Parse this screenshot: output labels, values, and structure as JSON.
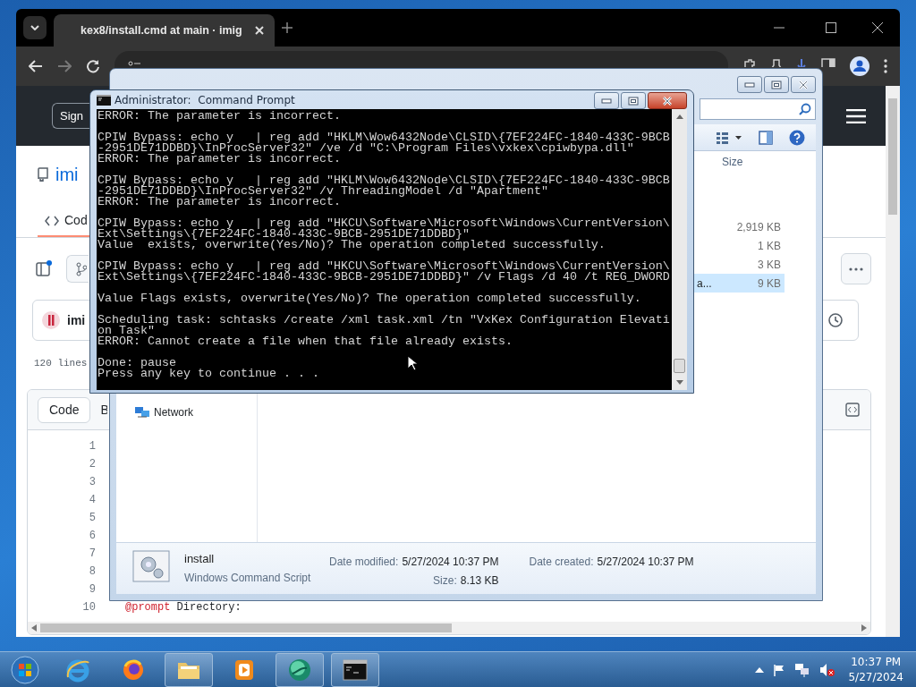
{
  "browser": {
    "tab_title": "kex8/install.cmd at main · imig",
    "page": {
      "sign_in": "Sign",
      "repo_name": "imi",
      "tab_label": "Cod",
      "commit_author": "imi",
      "lines_info": "120 lines",
      "view_buttons": [
        {
          "label": "Code",
          "selected": true
        },
        {
          "label": "B",
          "selected": false
        }
      ],
      "line_numbers": [
        "1",
        "2",
        "3",
        "4",
        "5",
        "6",
        "7",
        "8",
        "9",
        "10"
      ],
      "code_line": {
        "keyword": "@prompt",
        "text": "Directory:"
      }
    }
  },
  "explorer": {
    "column_header": "Size",
    "rows": [
      {
        "size": "2,919 KB",
        "selected": false
      },
      {
        "size": "1 KB",
        "selected": false
      },
      {
        "size": "3 KB",
        "selected": false
      },
      {
        "name": "a...",
        "size": "9 KB",
        "selected": true
      }
    ],
    "nav_items": [
      "Network"
    ],
    "details": {
      "name": "install",
      "type": "Windows Command Script",
      "fields": [
        {
          "label": "Date modified:",
          "value": "5/27/2024 10:37 PM"
        },
        {
          "label": "Size:",
          "value": "8.13 KB"
        },
        {
          "label": "Date created:",
          "value": "5/27/2024 10:37 PM"
        }
      ]
    }
  },
  "cmd": {
    "title": "Administrator:  Command Prompt",
    "blocks": [
      {
        "lines": [
          "ERROR: The parameter is incorrect."
        ]
      },
      {
        "lines": [
          "CPIW Bypass: echo y   | reg add \"HKLM\\Wow6432Node\\CLSID\\{7EF224FC-1840-433C-9BCB",
          "-2951DE71DDBD}\\InProcServer32\" /ve /d \"C:\\Program Files\\vxkex\\cpiwbypa.dll\"",
          "ERROR: The parameter is incorrect."
        ]
      },
      {
        "lines": [
          "CPIW Bypass: echo y   | reg add \"HKLM\\Wow6432Node\\CLSID\\{7EF224FC-1840-433C-9BCB",
          "-2951DE71DDBD}\\InProcServer32\" /v ThreadingModel /d \"Apartment\"",
          "ERROR: The parameter is incorrect."
        ]
      },
      {
        "lines": [
          "CPIW Bypass: echo y   | reg add \"HKCU\\Software\\Microsoft\\Windows\\CurrentVersion\\",
          "Ext\\Settings\\{7EF224FC-1840-433C-9BCB-2951DE71DDBD}\"",
          "Value  exists, overwrite(Yes/No)? The operation completed successfully."
        ]
      },
      {
        "lines": [
          "CPIW Bypass: echo y   | reg add \"HKCU\\Software\\Microsoft\\Windows\\CurrentVersion\\",
          "Ext\\Settings\\{7EF224FC-1840-433C-9BCB-2951DE71DDBD}\" /v Flags /d 40 /t REG_DWORD"
        ]
      },
      {
        "lines": [
          "Value Flags exists, overwrite(Yes/No)? The operation completed successfully."
        ]
      },
      {
        "lines": [
          "Scheduling task: schtasks /create /xml task.xml /tn \"VxKex Configuration Elevati",
          "on Task\"",
          "ERROR: Cannot create a file when that file already exists."
        ]
      },
      {
        "lines": [
          "Done: pause",
          "Press any key to continue . . ."
        ]
      }
    ]
  },
  "taskbar": {
    "apps": [
      {
        "kind": "ie",
        "open": false
      },
      {
        "kind": "firefox",
        "open": false
      },
      {
        "kind": "folder",
        "open": true
      },
      {
        "kind": "media",
        "open": false
      },
      {
        "kind": "globe",
        "open": true
      },
      {
        "kind": "console",
        "open": true
      }
    ],
    "clock": {
      "time": "10:37 PM",
      "date": "5/27/2024"
    }
  }
}
